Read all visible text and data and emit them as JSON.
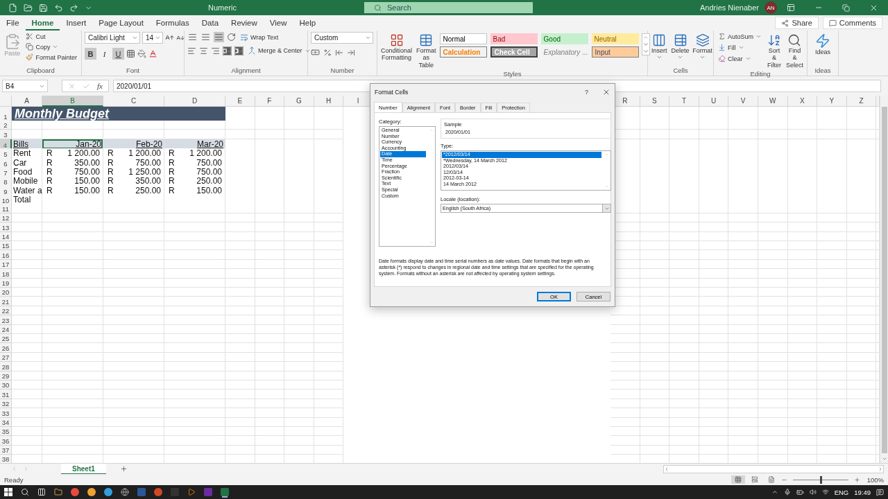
{
  "title_bar": {
    "document": "Numeric",
    "search_placeholder": "Search",
    "user": "Andries Nienaber",
    "initials": "AN"
  },
  "ribbon_tabs": [
    {
      "label": "File",
      "selected": false
    },
    {
      "label": "Home",
      "selected": true
    },
    {
      "label": "Insert",
      "selected": false
    },
    {
      "label": "Page Layout",
      "selected": false
    },
    {
      "label": "Formulas",
      "selected": false
    },
    {
      "label": "Data",
      "selected": false
    },
    {
      "label": "Review",
      "selected": false
    },
    {
      "label": "View",
      "selected": false
    },
    {
      "label": "Help",
      "selected": false
    }
  ],
  "ribbon_actions": [
    "Share",
    "Comments"
  ],
  "ribbon": {
    "clipboard": {
      "label": "Clipboard",
      "paste": "Paste",
      "paste_disabled": true,
      "cut": "Cut",
      "copy": "Copy",
      "format_painter": "Format Painter"
    },
    "font": {
      "label": "Font",
      "family": "Calibri Light",
      "size": "14",
      "toggles": [
        {
          "label": "B",
          "kind": "bold",
          "on": true
        },
        {
          "label": "I",
          "kind": "italic",
          "on": false
        },
        {
          "label": "U",
          "kind": "underline",
          "on": true
        }
      ]
    },
    "alignment": {
      "label": "Alignment",
      "vertical_align": [
        {
          "on": false
        },
        {
          "on": false
        },
        {
          "on": true
        }
      ],
      "wrap": "Wrap Text",
      "merge": "Merge & Center"
    },
    "number": {
      "label": "Number",
      "format": "Custom"
    },
    "styles": {
      "label": "Styles",
      "conditional": "Conditional Formatting",
      "table": "Format as Table",
      "gallery": [
        {
          "label": "Normal",
          "kind": "normal"
        },
        {
          "label": "Bad",
          "kind": "bad"
        },
        {
          "label": "Good",
          "kind": "good"
        },
        {
          "label": "Neutral",
          "kind": "neutral"
        },
        {
          "label": "Calculation",
          "kind": "calculation"
        },
        {
          "label": "Check Cell",
          "kind": "check"
        },
        {
          "label": "Explanatory ...",
          "kind": "explanatory"
        },
        {
          "label": "Input",
          "kind": "input"
        }
      ]
    },
    "cells": {
      "label": "Cells",
      "buttons": [
        "Insert",
        "Delete",
        "Format"
      ]
    },
    "editing": {
      "label": "Editing",
      "autosum": "AutoSum",
      "fill": "Fill",
      "clear": "Clear",
      "sort": "Sort & Filter",
      "find": "Find & Select"
    },
    "ideas": {
      "label": "Ideas",
      "button": "Ideas"
    }
  },
  "formula_bar": {
    "name_box": "B4",
    "function_label": "fx",
    "value": "2020/01/01"
  },
  "sheet": {
    "columns_left": [
      {
        "label": "A",
        "selected": false
      },
      {
        "label": "B",
        "selected": true
      },
      {
        "label": "C",
        "selected": false
      },
      {
        "label": "D",
        "selected": false
      },
      {
        "label": "E",
        "selected": false
      },
      {
        "label": "F",
        "selected": false
      },
      {
        "label": "G",
        "selected": false
      },
      {
        "label": "H",
        "selected": false
      },
      {
        "label": "I",
        "selected": false
      }
    ],
    "columns_right": [
      {
        "label": "R",
        "selected": false
      },
      {
        "label": "S",
        "selected": false
      },
      {
        "label": "T",
        "selected": false
      },
      {
        "label": "U",
        "selected": false
      },
      {
        "label": "V",
        "selected": false
      },
      {
        "label": "W",
        "selected": false
      },
      {
        "label": "X",
        "selected": false
      },
      {
        "label": "Y",
        "selected": false
      },
      {
        "label": "Z",
        "selected": false
      }
    ],
    "rows": [
      {
        "number": "1",
        "selected": false,
        "kind": "title",
        "text": "Monthly Budget"
      },
      {
        "number": "2",
        "selected": false
      },
      {
        "number": "3",
        "selected": false
      },
      {
        "number": "4",
        "selected": true,
        "kind": "header",
        "label": "Bills",
        "months": [
          "Jan-20",
          "Feb-20",
          "Mar-20"
        ]
      },
      {
        "number": "5",
        "selected": false,
        "kind": "data",
        "label": "Rent",
        "amounts": [
          {
            "currency": "R",
            "value": "1 200.00"
          },
          {
            "currency": "R",
            "value": "1 200.00"
          },
          {
            "currency": "R",
            "value": "1 200.00"
          }
        ]
      },
      {
        "number": "6",
        "selected": false,
        "kind": "data",
        "label": "Car",
        "amounts": [
          {
            "currency": "R",
            "value": "350.00"
          },
          {
            "currency": "R",
            "value": "750.00"
          },
          {
            "currency": "R",
            "value": "750.00"
          }
        ]
      },
      {
        "number": "7",
        "selected": false,
        "kind": "data",
        "label": "Food",
        "amounts": [
          {
            "currency": "R",
            "value": "750.00"
          },
          {
            "currency": "R",
            "value": "1 250.00"
          },
          {
            "currency": "R",
            "value": "750.00"
          }
        ]
      },
      {
        "number": "8",
        "selected": false,
        "kind": "data",
        "label": "Mobile",
        "amounts": [
          {
            "currency": "R",
            "value": "150.00"
          },
          {
            "currency": "R",
            "value": "350.00"
          },
          {
            "currency": "R",
            "value": "250.00"
          }
        ]
      },
      {
        "number": "9",
        "selected": false,
        "kind": "data",
        "label": "Water a",
        "amounts": [
          {
            "currency": "R",
            "value": "150.00"
          },
          {
            "currency": "R",
            "value": "250.00"
          },
          {
            "currency": "R",
            "value": "150.00"
          }
        ]
      },
      {
        "number": "10",
        "selected": false,
        "kind": "label",
        "label": "Total"
      },
      {
        "number": "11",
        "selected": false
      },
      {
        "number": "12",
        "selected": false
      },
      {
        "number": "13",
        "selected": false
      },
      {
        "number": "14",
        "selected": false
      },
      {
        "number": "15",
        "selected": false
      },
      {
        "number": "16",
        "selected": false
      },
      {
        "number": "17",
        "selected": false
      },
      {
        "number": "18",
        "selected": false
      },
      {
        "number": "19",
        "selected": false
      },
      {
        "number": "20",
        "selected": false
      },
      {
        "number": "21",
        "selected": false
      },
      {
        "number": "22",
        "selected": false
      },
      {
        "number": "23",
        "selected": false
      },
      {
        "number": "24",
        "selected": false
      },
      {
        "number": "25",
        "selected": false
      },
      {
        "number": "26",
        "selected": false
      },
      {
        "number": "27",
        "selected": false
      },
      {
        "number": "28",
        "selected": false
      },
      {
        "number": "29",
        "selected": false
      },
      {
        "number": "30",
        "selected": false
      },
      {
        "number": "31",
        "selected": false
      },
      {
        "number": "32",
        "selected": false
      },
      {
        "number": "33",
        "selected": false
      },
      {
        "number": "34",
        "selected": false
      },
      {
        "number": "35",
        "selected": false
      },
      {
        "number": "36",
        "selected": false
      },
      {
        "number": "37",
        "selected": false
      },
      {
        "number": "38",
        "selected": false
      }
    ]
  },
  "sheet_tabs": [
    {
      "label": "Sheet1",
      "selected": true
    }
  ],
  "status_bar": {
    "text": "Ready",
    "views": [
      {
        "selected": true
      },
      {
        "selected": false
      },
      {
        "selected": false
      }
    ],
    "zoom_slider": {
      "level": 0.5
    },
    "zoom": "100%"
  },
  "taskbar": {
    "language": "ENG",
    "time": "19:49"
  },
  "dialog": {
    "title": "Format Cells",
    "help": "?",
    "tabs": [
      {
        "label": "Number",
        "selected": true
      },
      {
        "label": "Alignment",
        "selected": false
      },
      {
        "label": "Font",
        "selected": false
      },
      {
        "label": "Border",
        "selected": false
      },
      {
        "label": "Fill",
        "selected": false
      },
      {
        "label": "Protection",
        "selected": false
      }
    ],
    "category_label": "Category:",
    "categories": [
      {
        "label": "General",
        "selected": false
      },
      {
        "label": "Number",
        "selected": false
      },
      {
        "label": "Currency",
        "selected": false
      },
      {
        "label": "Accounting",
        "selected": false
      },
      {
        "label": "Date",
        "selected": true
      },
      {
        "label": "Time",
        "selected": false
      },
      {
        "label": "Percentage",
        "selected": false
      },
      {
        "label": "Fraction",
        "selected": false
      },
      {
        "label": "Scientific",
        "selected": false
      },
      {
        "label": "Text",
        "selected": false
      },
      {
        "label": "Special",
        "selected": false
      },
      {
        "label": "Custom",
        "selected": false
      }
    ],
    "sample_label": "Sample",
    "sample": "2020/01/01",
    "type_label": "Type:",
    "types": [
      {
        "label": "*2012/03/14",
        "selected": true
      },
      {
        "label": "*Wednesday, 14 March 2012",
        "selected": false
      },
      {
        "label": "2012/03/14",
        "selected": false
      },
      {
        "label": "12/03/14",
        "selected": false
      },
      {
        "label": "2012-03-14",
        "selected": false
      },
      {
        "label": "14 March 2012",
        "selected": false
      }
    ],
    "locale_label": "Locale (location):",
    "locale": "English (South Africa)",
    "description": "Date formats display date and time serial numbers as date values. Date formats that begin with an asterisk (*) respond to changes in regional date and time settings that are specified for the operating system. Formats without an asterisk are not affected by operating system settings.",
    "buttons": [
      {
        "label": "OK",
        "kind": "primary"
      },
      {
        "label": "Cancel",
        "kind": "secondary"
      }
    ]
  }
}
